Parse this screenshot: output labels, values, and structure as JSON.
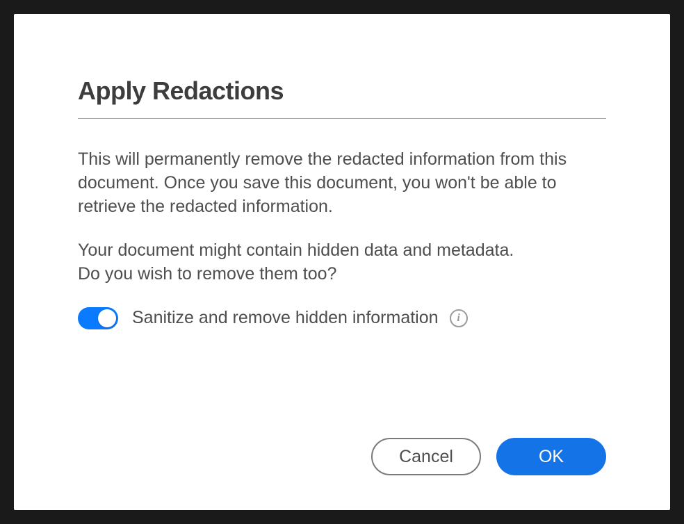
{
  "dialog": {
    "title": "Apply Redactions",
    "paragraph1": "This will permanently remove the redacted information from this document. Once you save this document, you won't be able to retrieve the redacted information.",
    "paragraph2_line1": "Your document might contain hidden data and metadata.",
    "paragraph2_line2": "Do you wish to remove them too?",
    "toggle_label": "Sanitize and remove hidden information",
    "info_glyph": "i",
    "buttons": {
      "cancel": "Cancel",
      "ok": "OK"
    }
  }
}
